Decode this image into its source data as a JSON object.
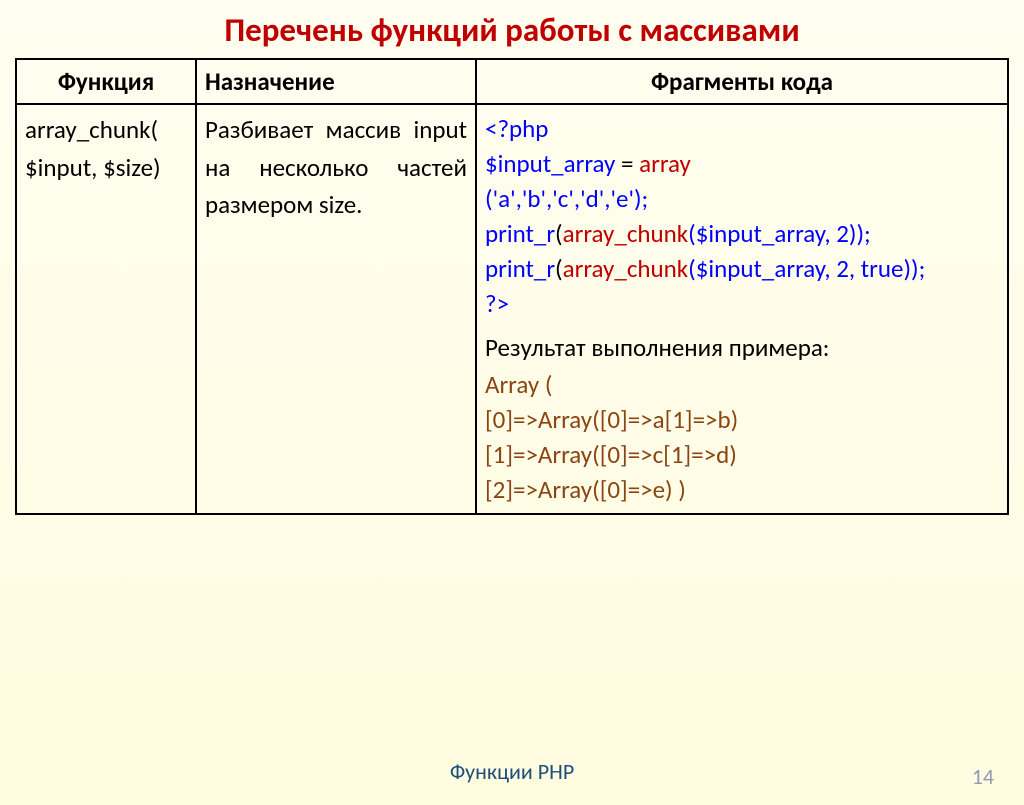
{
  "title": "Перечень функций работы с массивами",
  "headers": {
    "col1": "Функция",
    "col2": "Назначение",
    "col3": "Фрагменты кода"
  },
  "row": {
    "function_line1": "array_chunk(",
    "function_line2": "$input, $size)",
    "description": "Разбивает массив input на несколько частей размером size.",
    "code": {
      "open_tag": "<?php",
      "var": "$input_array",
      "equals": " = ",
      "array_keyword": "array",
      "array_args": "('a','b','c','d','e');",
      "print1_func": "print_r",
      "print1_open": "(",
      "print1_call": "array_chunk",
      "print1_args": "($input_array, 2));",
      "print2_func": "print_r",
      "print2_open": "(",
      "print2_call": "array_chunk",
      "print2_args": "($input_array, 2, ",
      "print2_true": "true",
      "print2_close": "));",
      "close_tag": "?>"
    },
    "result_label": "Результат выполнения примера:",
    "result": {
      "line1": "Array (",
      "line2": "[0]=>Array([0]=>a[1]=>b)",
      "line3": "[1]=>Array([0]=>c[1]=>d)",
      "line4": "[2]=>Array([0]=>e) )"
    }
  },
  "footer": "Функции PHP",
  "page_number": "14"
}
